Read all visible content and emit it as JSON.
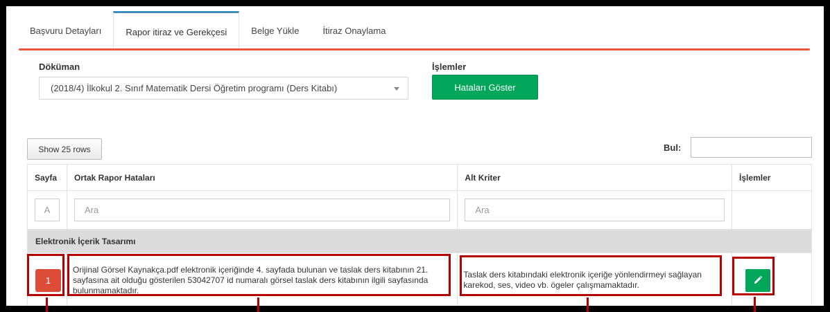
{
  "tabs": [
    {
      "label": "Başvuru Detayları",
      "active": false
    },
    {
      "label": "Rapor itiraz ve Gerekçesi",
      "active": true
    },
    {
      "label": "Belge Yükle",
      "active": false
    },
    {
      "label": "İtiraz Onaylama",
      "active": false
    }
  ],
  "form": {
    "document_label": "Döküman",
    "document_value": "(2018/4) İlkokul 2. Sınıf Matematik Dersi Öğretim programı (Ders Kitabı)",
    "actions_label": "İşlemler",
    "show_errors_button": "Hataları Göster"
  },
  "table_controls": {
    "rows_button": "Show 25 rows",
    "search_label": "Bul:",
    "search_value": ""
  },
  "table": {
    "columns": [
      "Sayfa",
      "Ortak Rapor Hataları",
      "Alt Kriter",
      "İşlemler"
    ],
    "filters": {
      "page": "A",
      "errors": "Ara",
      "criteria": "Ara"
    },
    "group": "Elektronik İçerik Tasarımı",
    "rows": [
      {
        "page": "1",
        "error_text": "Orijinal Görsel Kaynakça.pdf elektronik içeriğinde 4. sayfada bulunan ve taslak ders kitabının 21. sayfasına ait olduğu gösterilen 53042707 id numaralı görsel taslak ders kitabının ilgili sayfasında bulunmamaktadır.",
        "criteria_text": "Taslak ders kitabındaki elektronik içeriğe yönlendirmeyi sağlayan karekod, ses, video vb. ögeler çalışmamaktadır."
      }
    ]
  },
  "colors": {
    "tab_accent": "#3c8dbc",
    "rule_accent": "#e8573c",
    "success": "#00a65a",
    "danger": "#dd4b39",
    "annotation": "#b30000"
  },
  "icons": {
    "edit": "pencil-icon",
    "dropdown": "caret-down-icon"
  }
}
